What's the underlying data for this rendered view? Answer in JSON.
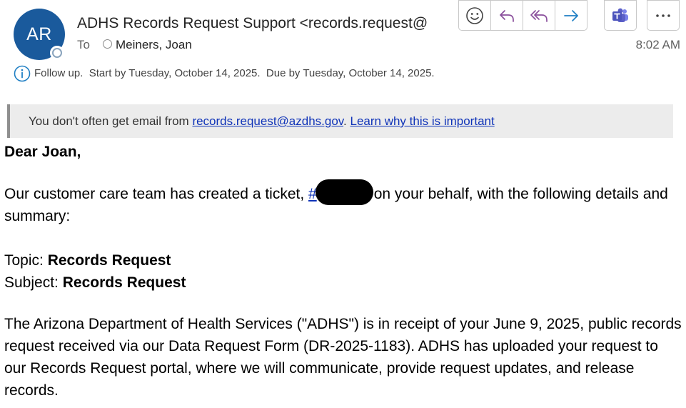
{
  "header": {
    "avatar_initials": "AR",
    "sender_display": "ADHS Records Request Support <records.request@",
    "to_label": "To",
    "recipient": "Meiners, Joan",
    "time": "8:02 AM"
  },
  "toolbar": {
    "icons": [
      "emoji-icon",
      "reply-icon",
      "reply-all-icon",
      "forward-icon",
      "teams-icon",
      "more-icon"
    ]
  },
  "followup": {
    "text": "Follow up.  Start by Tuesday, October 14, 2025.  Due by Tuesday, October 14, 2025."
  },
  "banner": {
    "prefix": "You don't often get email from ",
    "email_link": "records.request@azdhs.gov",
    "separator": ". ",
    "learn_link": "Learn why this is important"
  },
  "body": {
    "greeting": "Dear Joan,",
    "ticket_prefix": "Our customer care team has created a ticket, ",
    "ticket_hash": "#",
    "ticket_suffix": "on your behalf, with the following details and summary:",
    "topic_label": "Topic: ",
    "topic_value": "Records Request",
    "subject_label": "Subject: ",
    "subject_value": "Records Request",
    "paragraph": "The Arizona Department of Health Services (\"ADHS\") is in receipt of your June 9, 2025, public records request received via our Data Request Form (DR-2025-1183). ADHS has uploaded your request to our Records Request portal, where we will communicate, provide request updates, and release records."
  },
  "colors": {
    "avatar_bg": "#1a5a9c",
    "action_blue": "#1f7fc4",
    "teams_purple": "#5b5fc7",
    "link": "#0f33b8",
    "banner_bg": "#ececec"
  }
}
